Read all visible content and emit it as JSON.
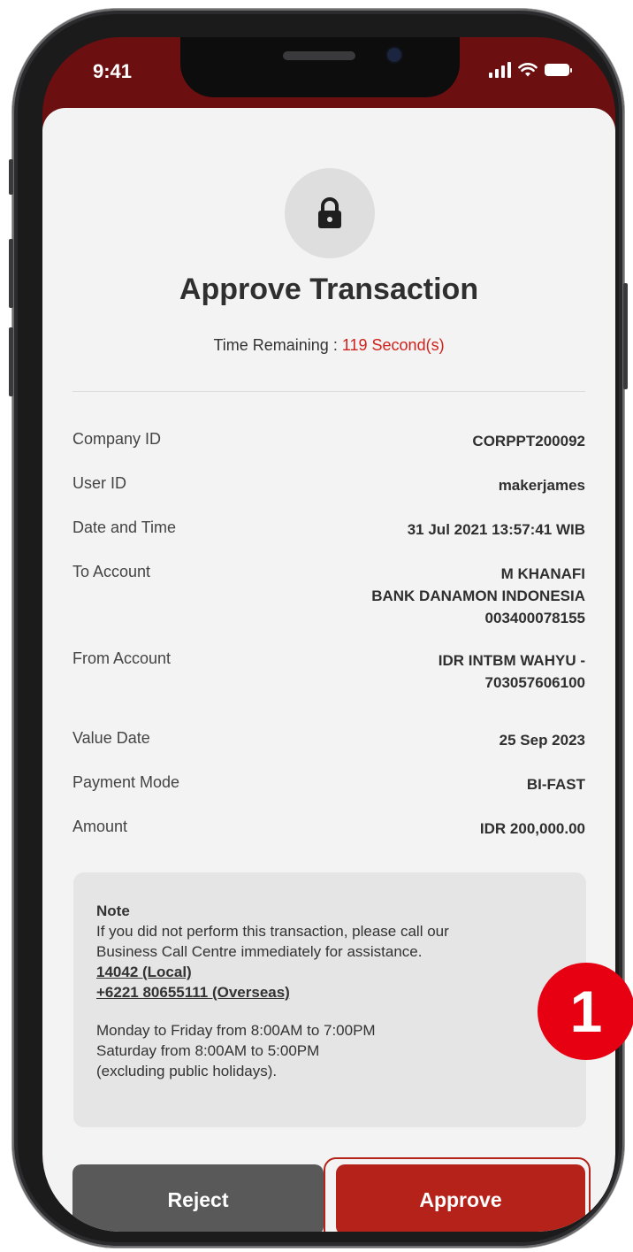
{
  "status_bar": {
    "time": "9:41"
  },
  "header": {
    "title": "Approve Transaction",
    "timer_label": "Time Remaining : ",
    "timer_value": "119 Second(s)"
  },
  "details": [
    {
      "label": "Company ID",
      "value": [
        "CORPPT200092"
      ]
    },
    {
      "label": "User ID",
      "value": [
        "makerjames"
      ]
    },
    {
      "label": "Date and Time",
      "value": [
        "31 Jul 2021 13:57:41 WIB"
      ]
    },
    {
      "label": "To Account",
      "value": [
        "M KHANAFI",
        "BANK DANAMON INDONESIA",
        "003400078155"
      ]
    },
    {
      "label": "From Account",
      "value": [
        "IDR INTBM WAHYU -",
        "703057606100"
      ]
    },
    {
      "label": "Value Date",
      "value": [
        "25 Sep 2023"
      ]
    },
    {
      "label": "Payment Mode",
      "value": [
        "BI-FAST"
      ]
    },
    {
      "label": "Amount",
      "value": [
        "IDR 200,000.00"
      ]
    }
  ],
  "note": {
    "title": "Note",
    "line1": "If you did not perform this transaction, please call our",
    "line2": "Business Call Centre immediately for assistance.",
    "phone_local": "14042 (Local)",
    "phone_overseas": "+6221 80655111 (Overseas)",
    "hours1": "Monday to Friday from 8:00AM to 7:00PM",
    "hours2": "Saturday from 8:00AM to 5:00PM",
    "hours3": "(excluding public holidays)."
  },
  "actions": {
    "reject_label": "Reject",
    "approve_label": "Approve"
  },
  "annotation": {
    "step": "1"
  },
  "colors": {
    "accent": "#b52219",
    "timer": "#d0221c",
    "header_bg": "#6b0f10"
  }
}
